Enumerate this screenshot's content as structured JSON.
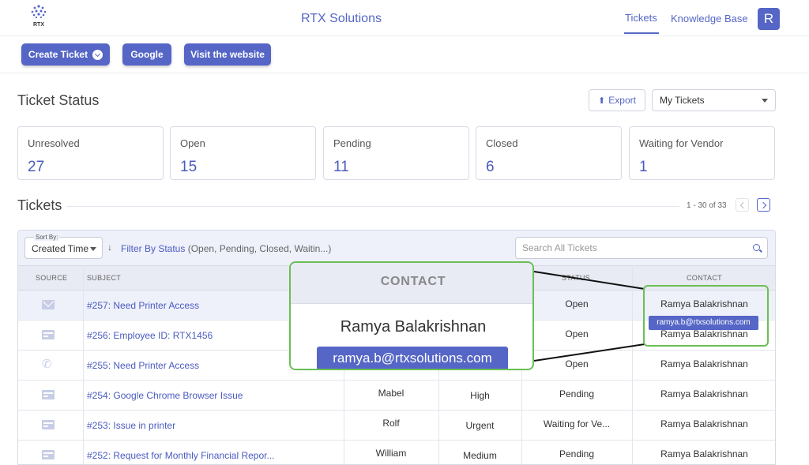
{
  "header": {
    "logo_text": "RTX",
    "app_title": "RTX Solutions",
    "nav": {
      "tickets": "Tickets",
      "knowledge_base": "Knowledge Base"
    },
    "avatar_initial": "R"
  },
  "actions": {
    "create_ticket": "Create Ticket",
    "google": "Google",
    "visit_website": "Visit the website"
  },
  "ticket_status": {
    "title": "Ticket Status",
    "export_label": "Export",
    "view_select": "My Tickets",
    "cards": [
      {
        "label": "Unresolved",
        "value": "27"
      },
      {
        "label": "Open",
        "value": "15"
      },
      {
        "label": "Pending",
        "value": "11"
      },
      {
        "label": "Closed",
        "value": "6"
      },
      {
        "label": "Waiting for Vendor",
        "value": "1"
      }
    ]
  },
  "tickets": {
    "title": "Tickets",
    "pagination": "1 - 30 of 33",
    "sort_label": "Sort By:",
    "sort_value": "Created Time",
    "filter_link": "Filter By Status",
    "filter_hint": "(Open, Pending, Closed, Waitin...)",
    "search_placeholder": "Search All Tickets",
    "columns": {
      "source": "SOURCE",
      "subject": "SUBJECT",
      "status": "STATUS",
      "contact": "CONTACT"
    },
    "rows": [
      {
        "source_icon": "email-icon",
        "subject": "#257: Need Printer Access",
        "agent": "",
        "priority": "",
        "status": "Open",
        "contact": "Ramya Balakrishnan"
      },
      {
        "source_icon": "web-form-icon",
        "subject": "#256: Employee ID: RTX1456",
        "agent": "",
        "priority": "",
        "status": "Open",
        "contact": "Ramya Balakrishnan"
      },
      {
        "source_icon": "phone-icon",
        "subject": "#255: Need Printer Access",
        "agent": "",
        "priority": "",
        "status": "Open",
        "contact": "Ramya Balakrishnan"
      },
      {
        "source_icon": "web-form-icon",
        "subject": "#254: Google Chrome Browser Issue",
        "agent": "Mabel",
        "priority": "High",
        "status": "Pending",
        "contact": "Ramya Balakrishnan"
      },
      {
        "source_icon": "web-form-icon",
        "subject": "#253: Issue in printer",
        "agent": "Rolf",
        "priority": "Urgent",
        "status": "Waiting for Ve...",
        "contact": "Ramya Balakrishnan"
      },
      {
        "source_icon": "web-form-icon",
        "subject": "#252: Request for Monthly Financial Repor...",
        "agent": "William",
        "priority": "Medium",
        "status": "Pending",
        "contact": "Ramya Balakrishnan"
      }
    ]
  },
  "callout": {
    "column_header": "CONTACT",
    "contact_name": "Ramya Balakrishnan",
    "contact_email": "ramya.b@rtxsolutions.com",
    "highlight_color": "#6abf54"
  },
  "colors": {
    "accent": "#5566c6",
    "highlight": "#6abf54"
  }
}
